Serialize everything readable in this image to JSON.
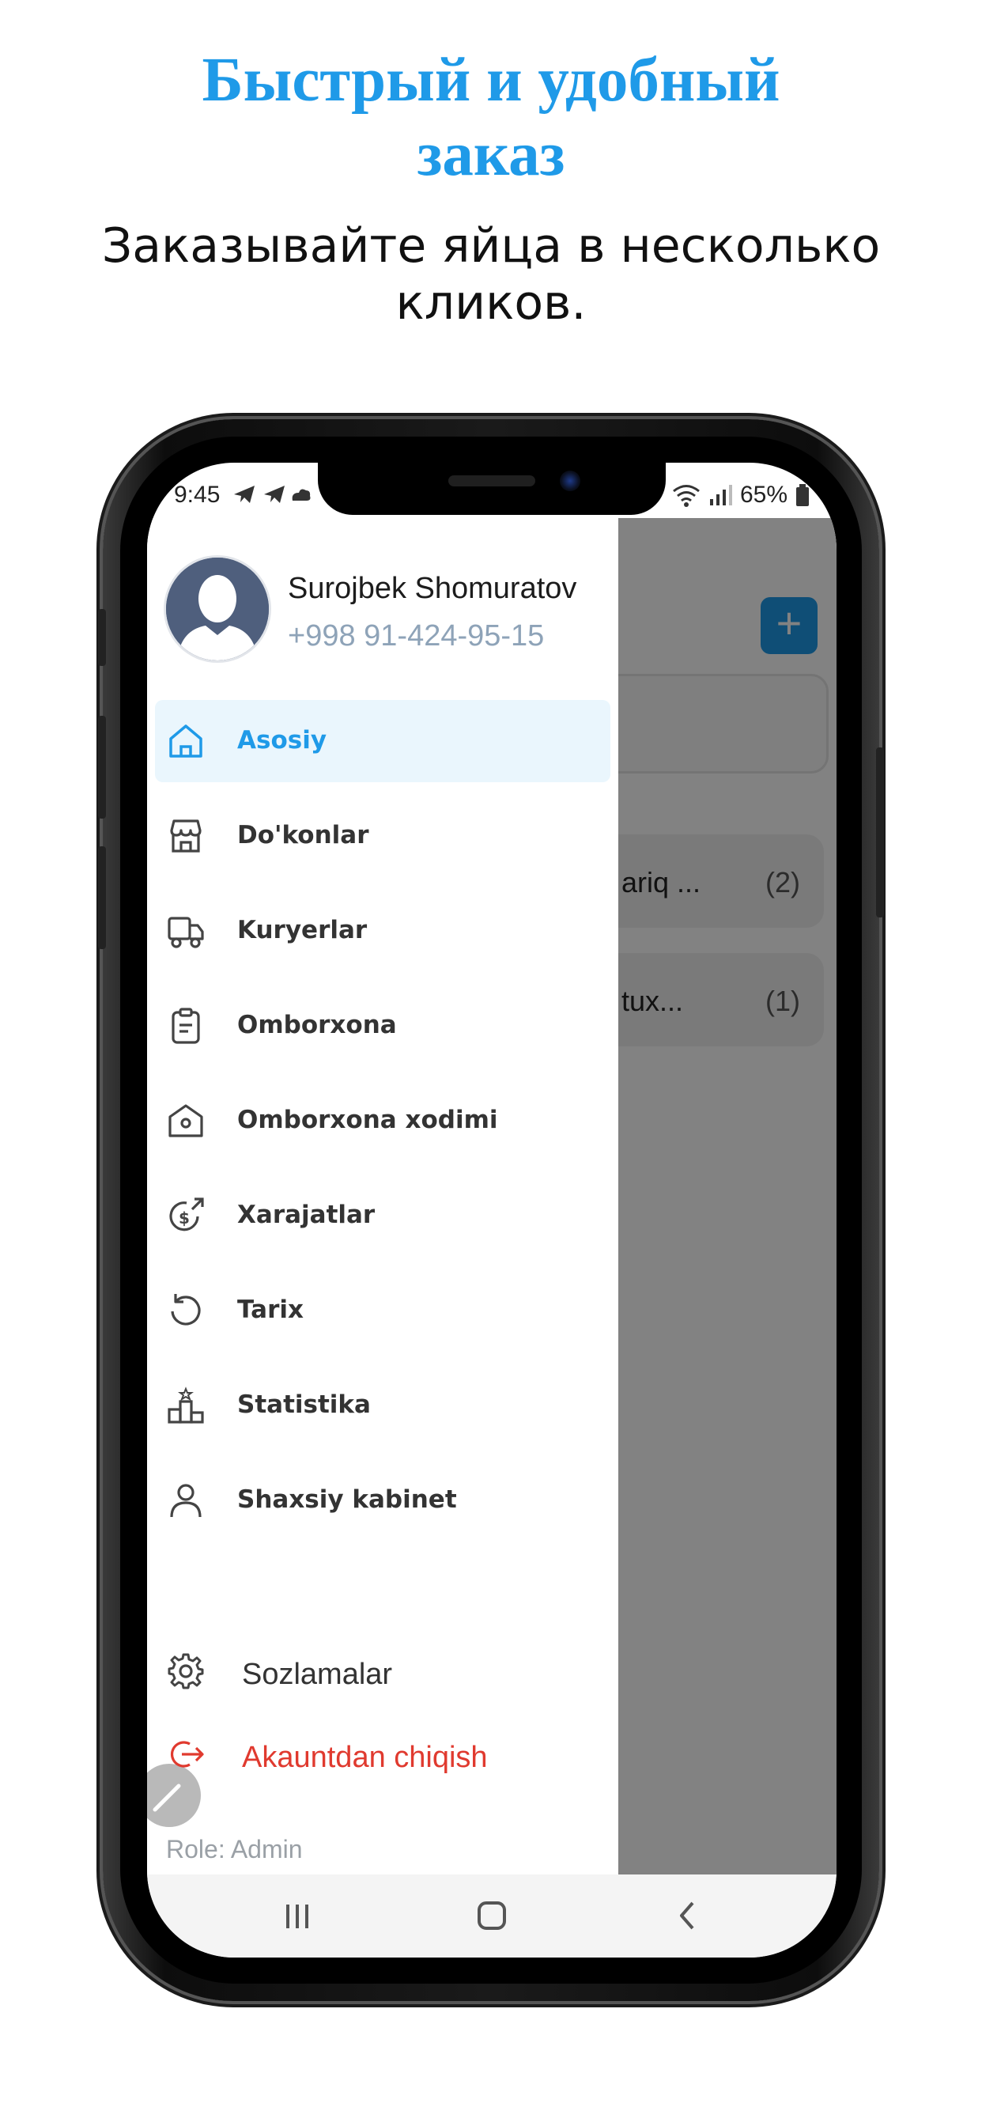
{
  "promo": {
    "title_line1": "Быстрый и удобный",
    "title_line2": "заказ",
    "subtitle_line1": "Заказывайте яйца в несколько",
    "subtitle_line2": "кликов."
  },
  "status_bar": {
    "time": "9:45",
    "battery": "65%"
  },
  "background_screen": {
    "add_button_label": "+",
    "cards": [
      {
        "text": "ariq ...",
        "count": "(2)"
      },
      {
        "text": "tux...",
        "count": "(1)"
      }
    ]
  },
  "drawer": {
    "profile": {
      "name": "Surojbek Shomuratov",
      "phone": "+998 91-424-95-15"
    },
    "menu": [
      {
        "label": "Asosiy",
        "icon": "home-icon",
        "active": true
      },
      {
        "label": "Do'konlar",
        "icon": "store-icon",
        "active": false
      },
      {
        "label": "Kuryerlar",
        "icon": "truck-icon",
        "active": false
      },
      {
        "label": "Omborxona",
        "icon": "clipboard-icon",
        "active": false
      },
      {
        "label": "Omborxona xodimi",
        "icon": "warehouse-icon",
        "active": false
      },
      {
        "label": "Xarajatlar",
        "icon": "expense-icon",
        "active": false
      },
      {
        "label": "Tarix",
        "icon": "history-icon",
        "active": false
      },
      {
        "label": "Statistika",
        "icon": "podium-icon",
        "active": false
      },
      {
        "label": "Shaxsiy kabinet",
        "icon": "user-icon",
        "active": false
      }
    ],
    "settings_label": "Sozlamalar",
    "logout_label": "Akauntdan chiqish",
    "role": "Role: Admin"
  },
  "colors": {
    "brand_blue": "#1f9ae8",
    "active_bg": "#eaf6fd",
    "logout_red": "#e03a2f",
    "phone_muted": "#8ea3b8"
  }
}
